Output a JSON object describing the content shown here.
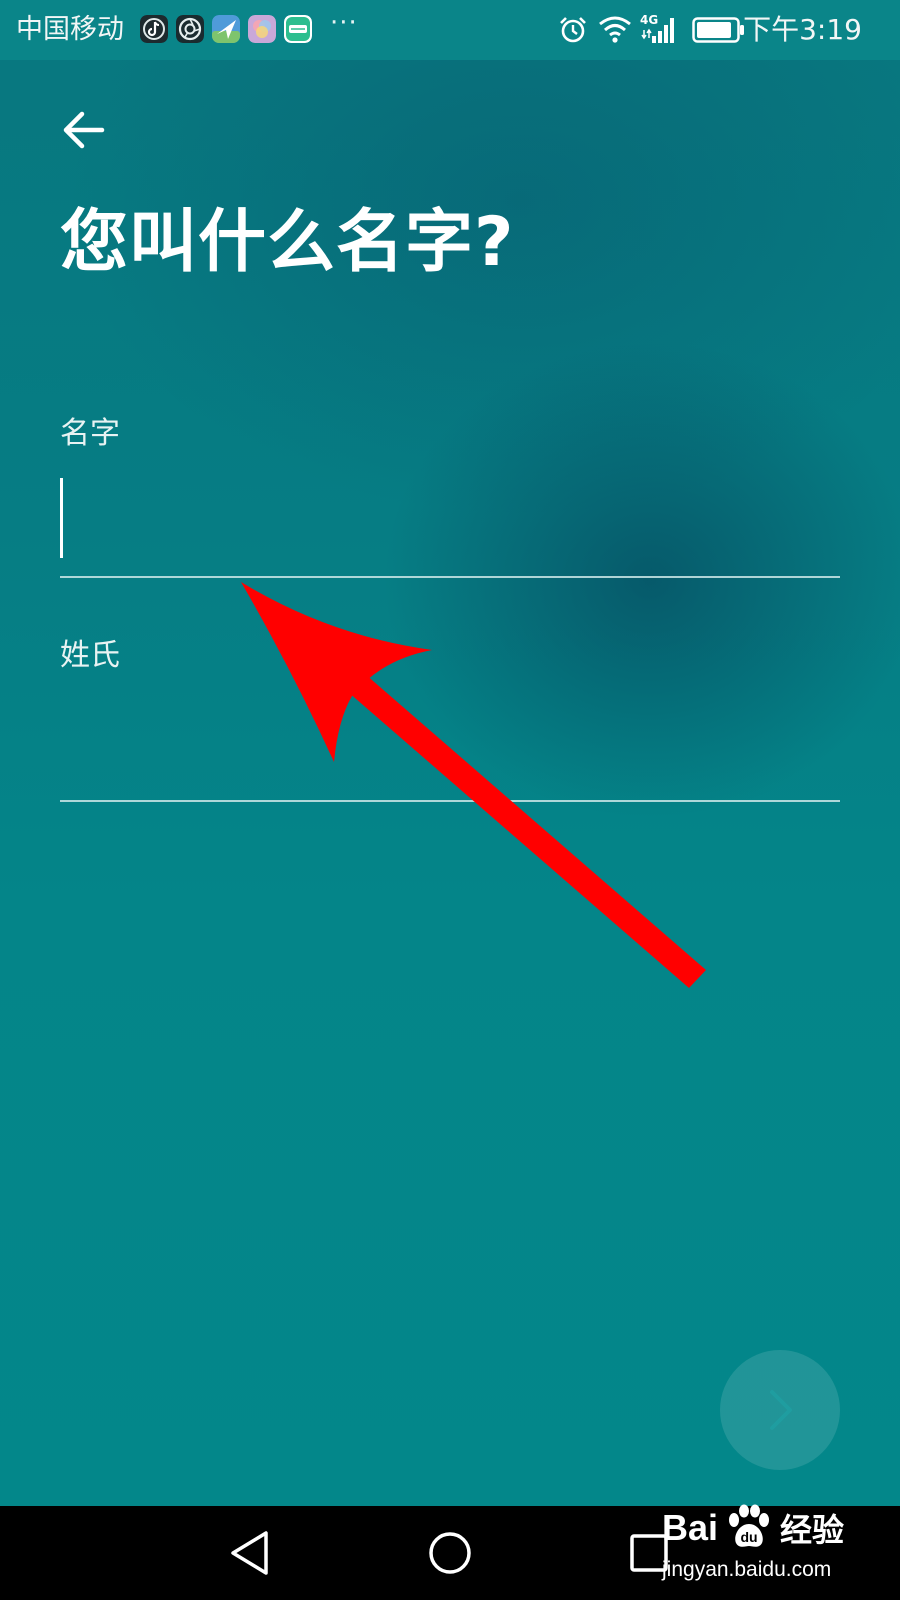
{
  "status_bar": {
    "carrier": "中国移动",
    "more": "···",
    "network_type": "4G",
    "time": "下午3:19",
    "notification_icons": [
      "tiktok-icon",
      "camera-app-icon",
      "maps-icon",
      "gallery-app-icon",
      "meituan-icon"
    ],
    "system_icons": [
      "alarm-icon",
      "wifi-icon",
      "cellular-signal-icon",
      "battery-icon"
    ]
  },
  "header": {
    "back_icon": "arrow-left-icon",
    "title": "您叫什么名字?"
  },
  "form": {
    "first_name": {
      "label": "名字",
      "value": "",
      "placeholder": ""
    },
    "last_name": {
      "label": "姓氏",
      "value": "",
      "placeholder": ""
    }
  },
  "next_button": {
    "icon": "chevron-right-icon"
  },
  "navigation_bar": {
    "buttons": [
      "triangle-back-icon",
      "circle-home-icon",
      "square-recents-icon"
    ]
  },
  "watermark": {
    "brand_prefix": "Bai",
    "brand_suffix": "经验",
    "url": "jingyan.baidu.com"
  },
  "colors": {
    "background": "#04868a",
    "status_bar": "#0a8589",
    "annotation_arrow": "#ff0000",
    "text": "#ffffff",
    "nav_bar": "#000000"
  }
}
